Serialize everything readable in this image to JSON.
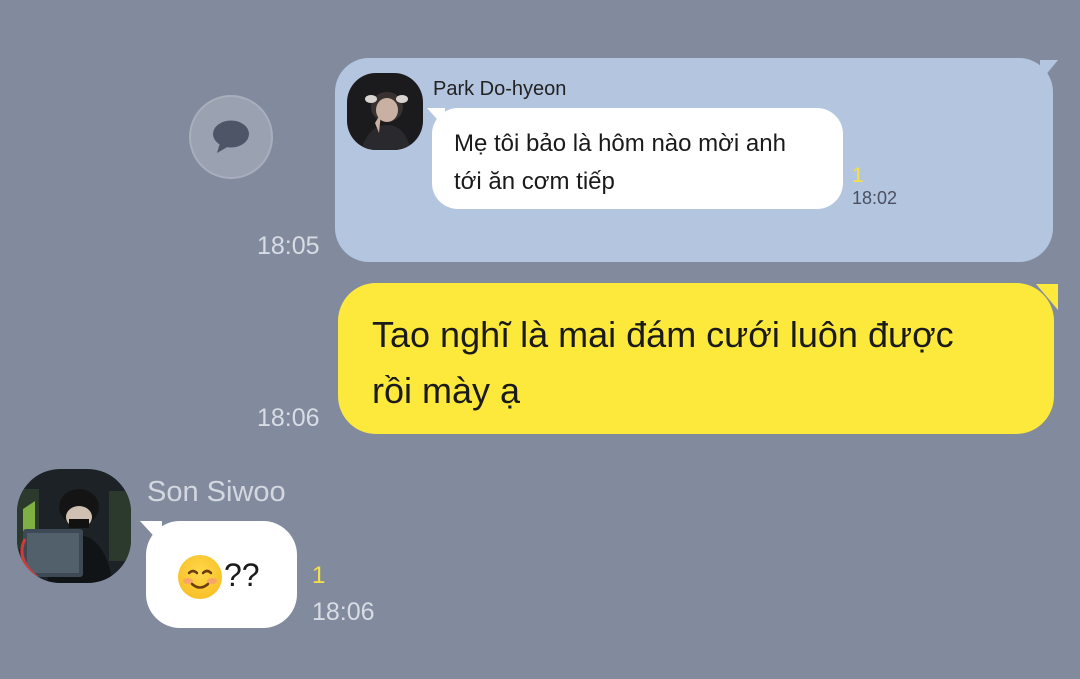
{
  "share_button": {
    "icon": "chat-bubble-icon"
  },
  "quoted_message": {
    "sender": "Park Do-hyeon",
    "text_line1": "Mẹ tôi bảo là hôm nào mời anh",
    "text_line2": "tới ăn cơm tiếp",
    "unread": "1",
    "time": "18:02"
  },
  "quote_send_time": "18:05",
  "my_message": {
    "line1": "Tao nghĩ là mai đám cưới luôn được",
    "line2": "rồi mày ạ",
    "time": "18:06"
  },
  "their_message": {
    "sender": "Son Siwoo",
    "emoji": "relieved-smile-emoji",
    "text": "??",
    "unread": "1",
    "time": "18:06"
  },
  "colors": {
    "background": "#828b9e",
    "my_bubble": "#fde93b",
    "quote_card": "#b4c5e0",
    "unread": "#f5e04a"
  }
}
